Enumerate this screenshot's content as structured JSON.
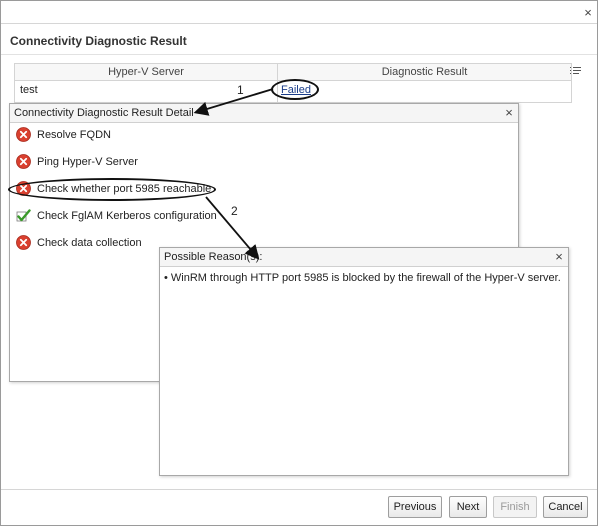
{
  "dialog": {
    "heading": "Connectivity Diagnostic Result",
    "close_glyph": "×"
  },
  "grid": {
    "columns": [
      "Hyper-V Server",
      "Diagnostic Result"
    ],
    "row": {
      "server": "test",
      "result": "Failed"
    }
  },
  "detail_panel": {
    "title": "Connectivity Diagnostic Result Detail",
    "close_glyph": "×",
    "checks": [
      {
        "label": "Resolve FQDN",
        "status": "failed"
      },
      {
        "label": "Ping Hyper-V Server",
        "status": "failed"
      },
      {
        "label": "Check whether port 5985 reachable",
        "status": "failed"
      },
      {
        "label": "Check FglAM Kerberos configuration",
        "status": "passed"
      },
      {
        "label": "Check data collection",
        "status": "failed"
      }
    ]
  },
  "reasons_panel": {
    "title": "Possible Reason(s):",
    "close_glyph": "×",
    "reason": "• WinRM through HTTP port 5985 is blocked by the firewall of the Hyper-V server."
  },
  "callouts": [
    "1",
    "2"
  ],
  "buttons": {
    "previous": "Previous",
    "next": "Next",
    "finish": "Finish",
    "cancel": "Cancel"
  },
  "colors": {
    "failed_icon": "#d9402f",
    "passed_icon": "#3a9a2a",
    "link": "#1a3d8a"
  }
}
